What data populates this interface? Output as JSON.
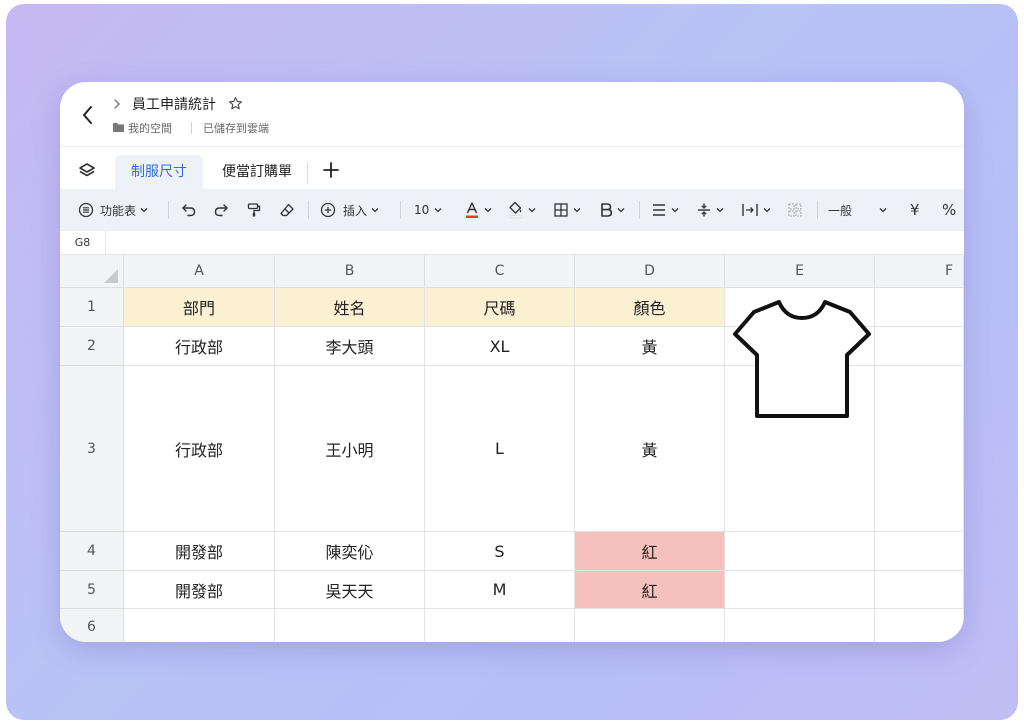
{
  "document": {
    "title": "員工申請統計",
    "location": "我的空間",
    "save_status": "已儲存到雲端"
  },
  "sheets": {
    "tabs": [
      {
        "label": "制服尺寸",
        "active": true
      },
      {
        "label": "便當訂購單",
        "active": false
      }
    ]
  },
  "toolbar": {
    "menu_label": "功能表",
    "insert_label": "插入",
    "font_size": "10",
    "number_format": "一般",
    "currency_symbol": "¥",
    "percent_symbol": "%"
  },
  "formula_bar": {
    "cell_ref": "G8"
  },
  "sheet": {
    "columns": [
      "A",
      "B",
      "C",
      "D",
      "E",
      "F"
    ],
    "rows": [
      {
        "num": "1",
        "cells": [
          "部門",
          "姓名",
          "尺碼",
          "顏色"
        ]
      },
      {
        "num": "2",
        "cells": [
          "行政部",
          "李大頭",
          "XL",
          "黃"
        ]
      },
      {
        "num": "3",
        "cells": [
          "行政部",
          "王小明",
          "L",
          "黃"
        ]
      },
      {
        "num": "4",
        "cells": [
          "開發部",
          "陳奕伈",
          "S",
          "紅"
        ]
      },
      {
        "num": "5",
        "cells": [
          "開發部",
          "吳天天",
          "M",
          "紅"
        ]
      },
      {
        "num": "6",
        "cells": [
          "",
          "",
          "",
          ""
        ]
      }
    ],
    "embedded_image": "t-shirt-icon"
  },
  "colors": {
    "background_gradient": [
      "#c6b8f3",
      "#b7bff7"
    ],
    "accent": "#2f6fe4",
    "header_fill": "#fcf0d3",
    "red_fill": "#f6c0bd",
    "font_color_underline": "#e5392f"
  }
}
